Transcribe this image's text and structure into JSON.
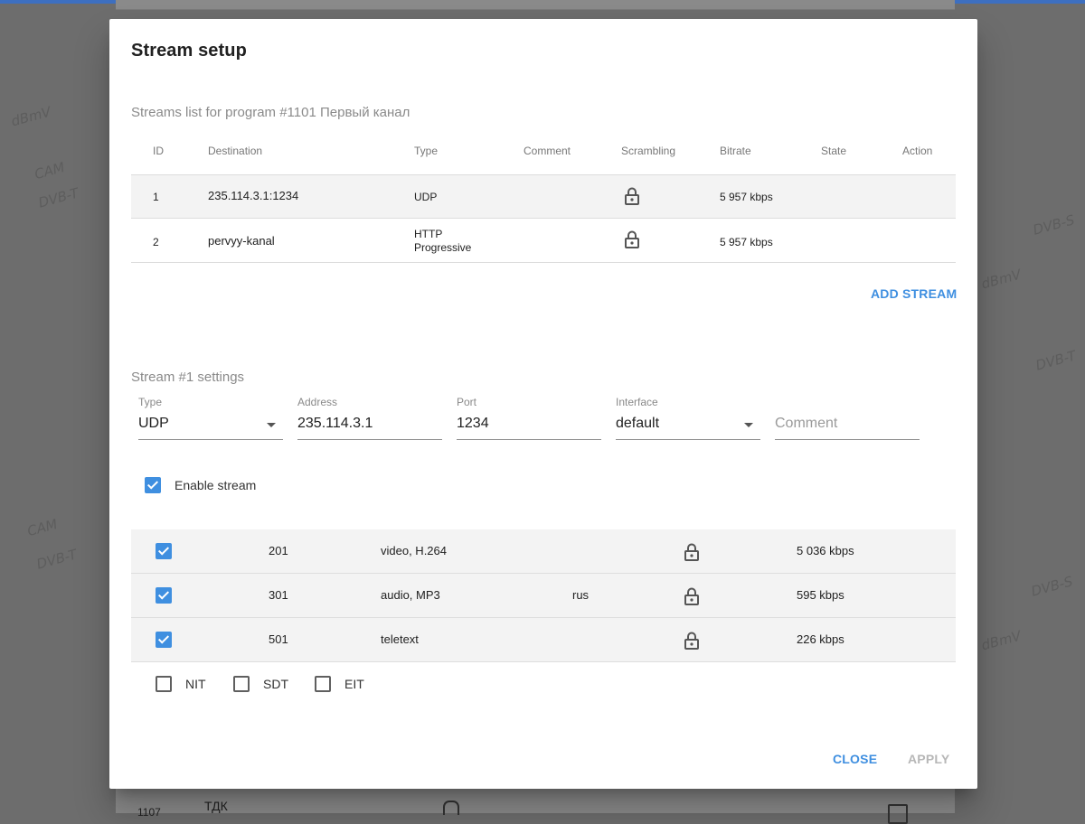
{
  "background": {
    "doodles": [
      "dBmV",
      "DVB-T",
      "DVB-S",
      "CAM",
      "dBmV",
      "DVB-T",
      "CAM",
      "DVB-S",
      "dBmV",
      "DVB-T"
    ],
    "underlying_row": {
      "id": "1107",
      "name": "ТДК"
    }
  },
  "dialog": {
    "title": "Stream setup",
    "streams_section_title": "Streams list for program #1101 Первый канал",
    "streams_table": {
      "headers": [
        "ID",
        "Destination",
        "Type",
        "Comment",
        "Scrambling",
        "Bitrate",
        "State",
        "Action"
      ],
      "rows": [
        {
          "id": "1",
          "destination": "235.114.3.1:1234",
          "type_line1": "UDP",
          "type_line2": "",
          "comment": "",
          "scrambling_icon": "unlock-icon",
          "bitrate": "5 957 kbps",
          "state": "",
          "action": ""
        },
        {
          "id": "2",
          "destination": "pervyy-kanal",
          "type_line1": "HTTP",
          "type_line2": "Progressive",
          "comment": "",
          "scrambling_icon": "unlock-icon",
          "bitrate": "5 957 kbps",
          "state": "",
          "action": ""
        }
      ]
    },
    "add_stream_label": "ADD STREAM",
    "settings_section_title": "Stream #1 settings",
    "fields": {
      "type": {
        "label": "Type",
        "value": "UDP"
      },
      "address": {
        "label": "Address",
        "value": "235.114.3.1"
      },
      "port": {
        "label": "Port",
        "value": "1234"
      },
      "interface": {
        "label": "Interface",
        "value": "default"
      },
      "comment": {
        "label": "",
        "placeholder": "Comment"
      }
    },
    "enable_stream": {
      "label": "Enable stream",
      "checked": true
    },
    "pids": [
      {
        "checked": true,
        "pid": "201",
        "type": "video, H.264",
        "lang": "",
        "lock_icon": "unlock-icon",
        "bitrate": "5 036 kbps"
      },
      {
        "checked": true,
        "pid": "301",
        "type": "audio, MP3",
        "lang": "rus",
        "lock_icon": "unlock-icon",
        "bitrate": "595 kbps"
      },
      {
        "checked": true,
        "pid": "501",
        "type": "teletext",
        "lang": "",
        "lock_icon": "unlock-icon",
        "bitrate": "226 kbps"
      }
    ],
    "tables": [
      {
        "label": "NIT",
        "checked": false
      },
      {
        "label": "SDT",
        "checked": false
      },
      {
        "label": "EIT",
        "checked": false
      }
    ],
    "close_label": "CLOSE",
    "apply_label": "APPLY",
    "accent_color": "#3f8fe0"
  }
}
